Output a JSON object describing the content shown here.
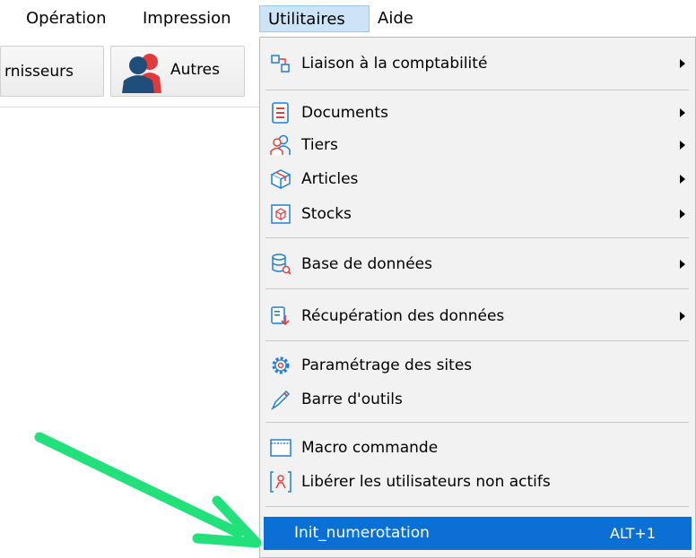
{
  "menubar": {
    "items": [
      {
        "label": "Opération"
      },
      {
        "label": "Impression"
      },
      {
        "label": "Utilitaires"
      },
      {
        "label": "Aide"
      }
    ]
  },
  "toolbar": {
    "fournisseurs_label": "rnisseurs",
    "autres_label": "Autres"
  },
  "menu": {
    "items": [
      {
        "label": "Liaison à la comptabilité",
        "icon": "link-accounting-icon"
      },
      {
        "label": "Documents",
        "icon": "document-icon"
      },
      {
        "label": "Tiers",
        "icon": "people-icon"
      },
      {
        "label": "Articles",
        "icon": "box-icon"
      },
      {
        "label": "Stocks",
        "icon": "stock-box-icon"
      },
      {
        "label": "Base de données",
        "icon": "database-icon"
      },
      {
        "label": "Récupération des données",
        "icon": "data-recovery-icon"
      },
      {
        "label": "Paramétrage des sites",
        "icon": "gear-icon"
      },
      {
        "label": "Barre d'outils",
        "icon": "pen-icon"
      },
      {
        "label": "Macro commande",
        "icon": "window-icon"
      },
      {
        "label": "Libérer les utilisateurs non actifs",
        "icon": "user-release-icon"
      },
      {
        "label": "Init_numerotation",
        "shortcut": "ALT+1"
      }
    ]
  },
  "colors": {
    "highlight": "#0b70d4",
    "arrow": "#22e07a"
  }
}
